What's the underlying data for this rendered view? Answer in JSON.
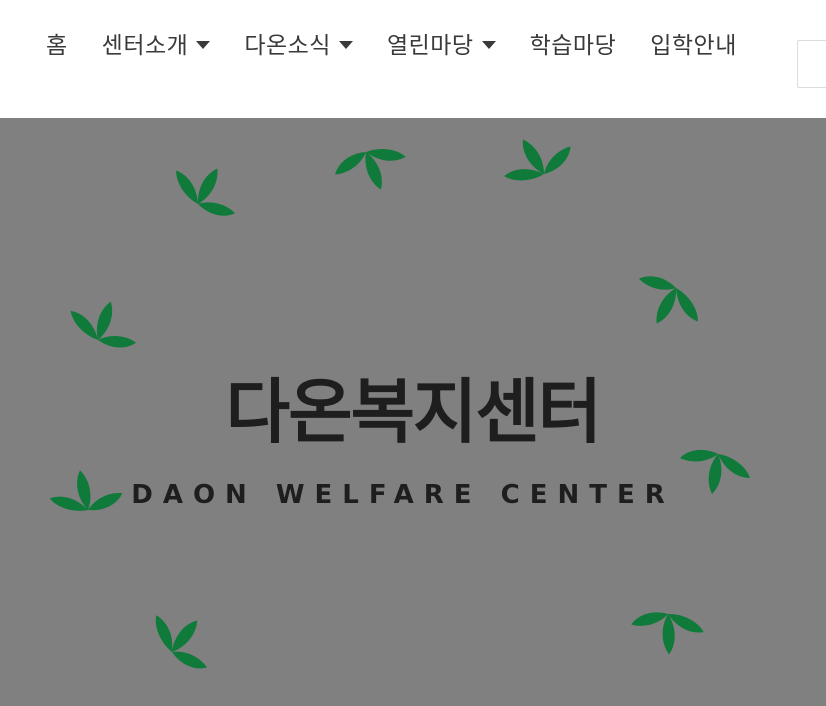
{
  "nav": {
    "items": [
      {
        "label": "홈",
        "has_dropdown": false
      },
      {
        "label": "센터소개",
        "has_dropdown": true
      },
      {
        "label": "다온소식",
        "has_dropdown": true
      },
      {
        "label": "열린마당",
        "has_dropdown": true
      },
      {
        "label": "학습마당",
        "has_dropdown": false
      },
      {
        "label": "입학안내",
        "has_dropdown": false
      }
    ]
  },
  "hero": {
    "title": "다온복지센터",
    "subtitle": "DAON WELFARE CENTER",
    "background_color": "#808080",
    "leaf_color": "#0f7a3a",
    "leaf_icon": "leaf-icon"
  }
}
